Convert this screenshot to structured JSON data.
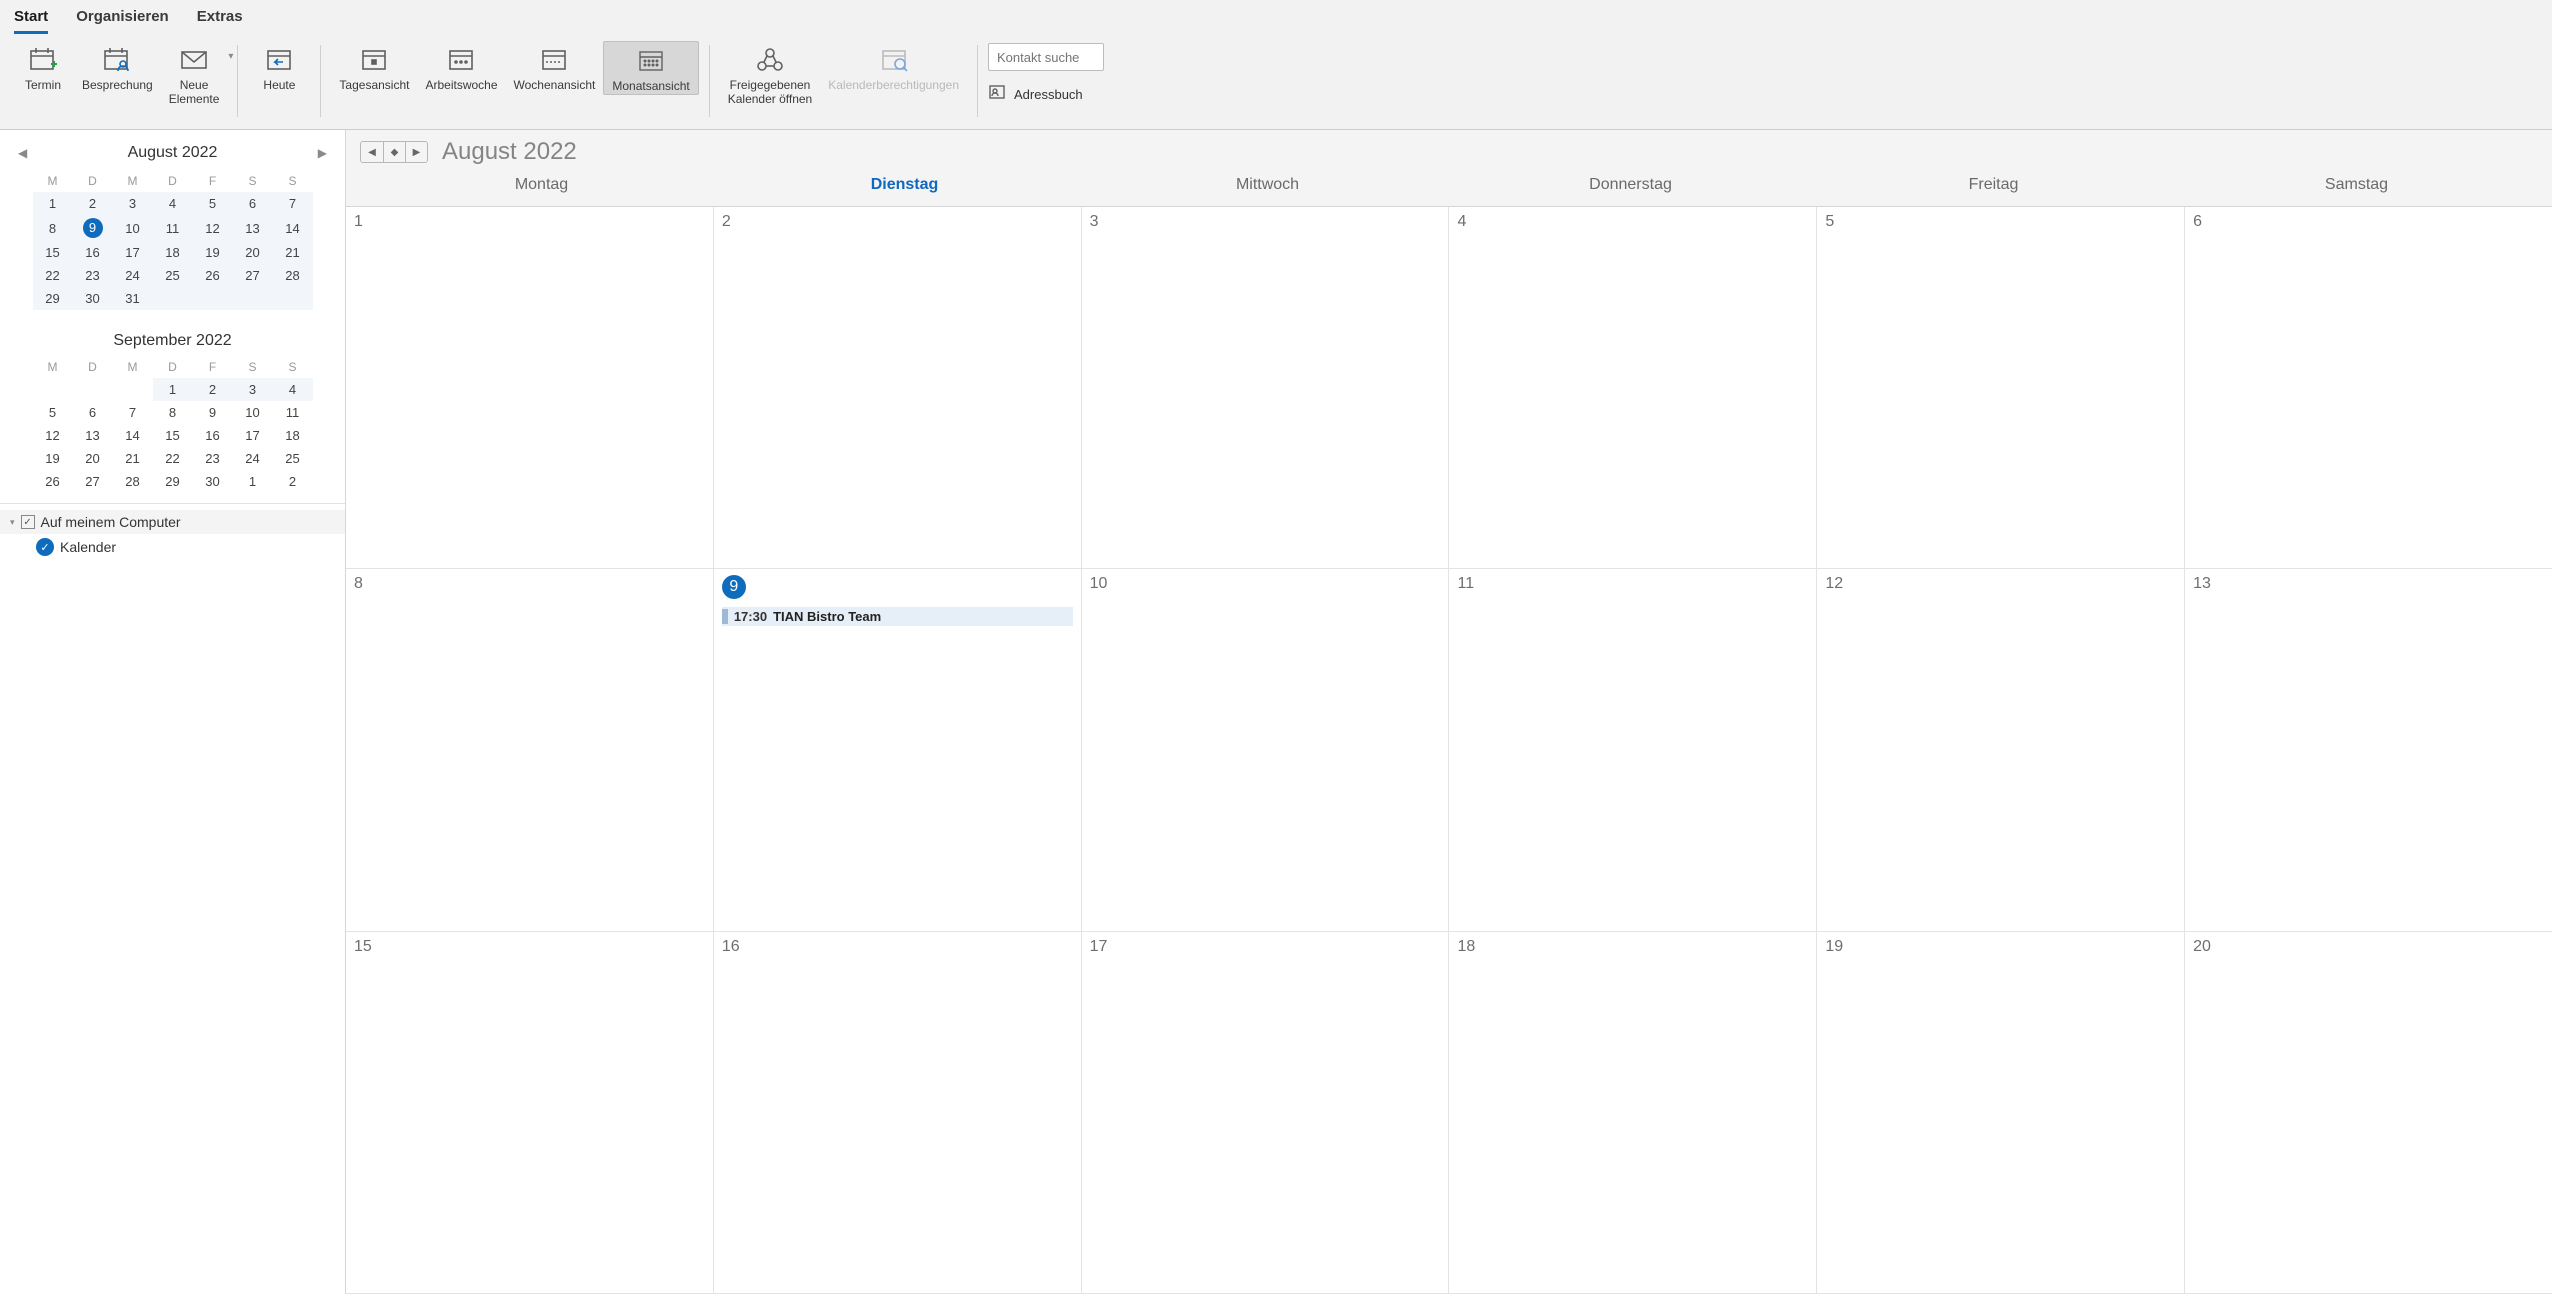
{
  "tabs": {
    "start": "Start",
    "organize": "Organisieren",
    "extras": "Extras"
  },
  "ribbon": {
    "termin": "Termin",
    "besprechung": "Besprechung",
    "neueElemente": "Neue\nElemente",
    "heute": "Heute",
    "tagesansicht": "Tagesansicht",
    "arbeitswoche": "Arbeitswoche",
    "wochenansicht": "Wochenansicht",
    "monatsansicht": "Monatsansicht",
    "freigegebenen": "Freigegebenen\nKalender öffnen",
    "kalenderberechtigungen": "Kalenderberechtigungen",
    "searchPlaceholder": "Kontakt suche",
    "adressbuch": "Adressbuch"
  },
  "miniCal": {
    "m1Title": "August 2022",
    "m2Title": "September 2022",
    "dow": [
      "M",
      "D",
      "M",
      "D",
      "F",
      "S",
      "S"
    ],
    "m1": [
      [
        "1",
        "2",
        "3",
        "4",
        "5",
        "6",
        "7"
      ],
      [
        "8",
        "9",
        "10",
        "11",
        "12",
        "13",
        "14"
      ],
      [
        "15",
        "16",
        "17",
        "18",
        "19",
        "20",
        "21"
      ],
      [
        "22",
        "23",
        "24",
        "25",
        "26",
        "27",
        "28"
      ],
      [
        "29",
        "30",
        "31",
        "",
        "",
        "",
        ""
      ]
    ],
    "m2": [
      [
        "",
        "",
        "",
        "1",
        "2",
        "3",
        "4"
      ],
      [
        "5",
        "6",
        "7",
        "8",
        "9",
        "10",
        "11"
      ],
      [
        "12",
        "13",
        "14",
        "15",
        "16",
        "17",
        "18"
      ],
      [
        "19",
        "20",
        "21",
        "22",
        "23",
        "24",
        "25"
      ],
      [
        "26",
        "27",
        "28",
        "29",
        "30",
        "1",
        "2"
      ]
    ]
  },
  "tree": {
    "groupLabel": "Auf meinem Computer",
    "calendarLabel": "Kalender"
  },
  "calendar": {
    "title": "August 2022",
    "dow": [
      "Montag",
      "Dienstag",
      "Mittwoch",
      "Donnerstag",
      "Freitag",
      "Samstag"
    ],
    "rows": [
      [
        "1",
        "2",
        "3",
        "4",
        "5",
        "6"
      ],
      [
        "8",
        "9",
        "10",
        "11",
        "12",
        "13"
      ],
      [
        "15",
        "16",
        "17",
        "18",
        "19",
        "20"
      ]
    ],
    "event": {
      "time": "17:30",
      "title": "TIAN Bistro Team"
    }
  }
}
